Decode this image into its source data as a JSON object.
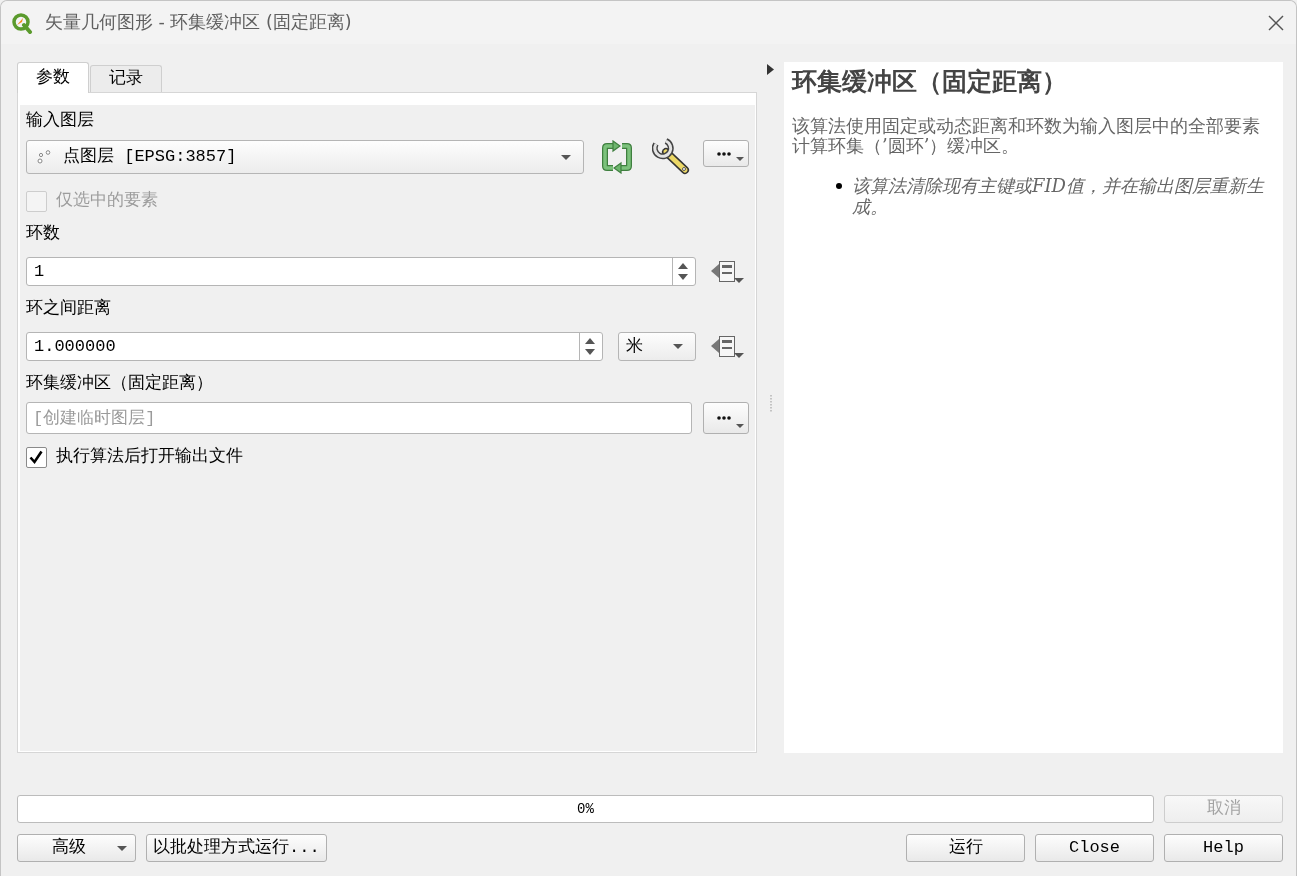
{
  "window": {
    "title": "矢量几何图形 - 环集缓冲区 (固定距离)"
  },
  "tabs": [
    {
      "label": "参数",
      "selected": true
    },
    {
      "label": "记录",
      "selected": false
    }
  ],
  "parameters": [
    {
      "kind": "layer",
      "label": "输入图层",
      "value": "点图层 [EPSG:3857]"
    },
    {
      "kind": "checkbox",
      "label": "仅选中的要素",
      "checked": false,
      "disabled": true
    },
    {
      "kind": "spin",
      "label": "环数",
      "value": "1"
    },
    {
      "kind": "spin_unit",
      "label": "环之间距离",
      "value": "1.000000",
      "unit": "米"
    },
    {
      "kind": "output",
      "label": "环集缓冲区（固定距离）",
      "placeholder": "[创建临时图层]"
    },
    {
      "kind": "checkbox",
      "label": "执行算法后打开输出文件",
      "checked": true,
      "disabled": false
    }
  ],
  "help": {
    "title": "环集缓冲区（固定距离）",
    "description": "该算法使用固定或动态距离和环数为输入图层中的全部要素计算环集（’圆环’）缓冲区。",
    "notes": [
      "该算法清除现有主键或FID值，并在输出图层重新生成。"
    ]
  },
  "progress": {
    "level": 0,
    "text": "0%"
  },
  "cancel_button": {
    "label": "取消",
    "disabled": true
  },
  "left_buttons": [
    {
      "label": "高级",
      "kind": "menu"
    },
    {
      "label": "以批处理方式运行...",
      "kind": "push"
    }
  ],
  "right_buttons": [
    {
      "label": "运行",
      "kind": "push"
    },
    {
      "label": "Close",
      "kind": "push"
    },
    {
      "label": "Help",
      "kind": "push"
    }
  ]
}
